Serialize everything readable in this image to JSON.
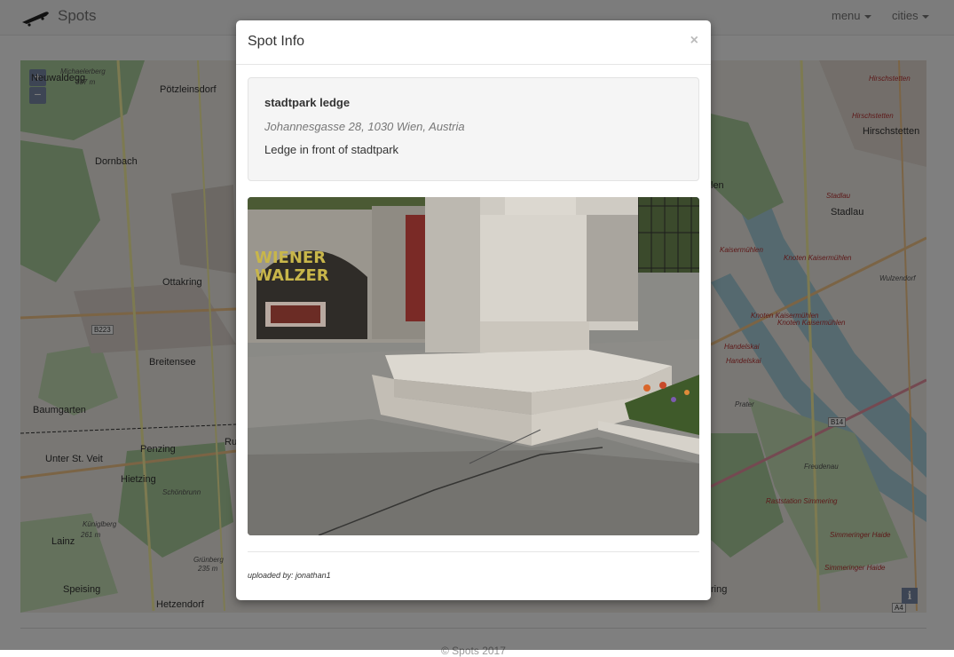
{
  "navbar": {
    "brand": "Spots",
    "menu_label": "menu",
    "cities_label": "cities"
  },
  "map": {
    "zoom_in": "+",
    "zoom_out": "−",
    "info": "i",
    "places": {
      "michaelerberg": "Michaelerberg",
      "michaelerberg_elev": "387 m",
      "poetzleinsdorf": "Pötzleinsdorf",
      "neuwaldegg": "Neuwaldegg",
      "dornbach": "Dornbach",
      "ottakring": "Ottakring",
      "breitensee": "Breitensee",
      "baumgarten": "Baumgarten",
      "penzing": "Penzing",
      "unter_st_veit": "Unter St. Veit",
      "hietzing": "Hietzing",
      "koeniglberg": "Küniglberg",
      "koeniglberg_elev": "261 m",
      "lainz": "Lainz",
      "speising": "Speising",
      "hetzendorf": "Hetzendorf",
      "gruenberg": "Grünberg",
      "gruenberg_elev": "235 m",
      "schoenbrunn": "Schönbrunn",
      "hirschstetten": "Hirschstetten",
      "stadlau": "Stadlau",
      "knoten_kaisermuehlen": "Knoten Kaisermühlen",
      "kaisermuehlen": "Kaisermühlen",
      "prater": "Prater",
      "freudenau": "Freudenau",
      "simmeringer_haide": "Simmeringer Haide",
      "raststation_simmering": "Raststation Simmering",
      "wulzendorf": "Wulzendorf",
      "handelskai": "Handelskai",
      "b223": "B223",
      "b14": "B14",
      "a4": "A4",
      "ru": "Ru",
      "len": "len",
      "ring": "ring"
    }
  },
  "modal": {
    "title": "Spot Info",
    "close": "×",
    "spot": {
      "name": "stadtpark ledge",
      "address": "Johannesgasse 28, 1030 Wien, Austria",
      "description": "Ledge in front of stadtpark"
    },
    "photo_sign": "WIENER\nWALZER",
    "uploaded_by": "uploaded by: jonathan1"
  },
  "footer": {
    "text": "© Spots 2017"
  }
}
